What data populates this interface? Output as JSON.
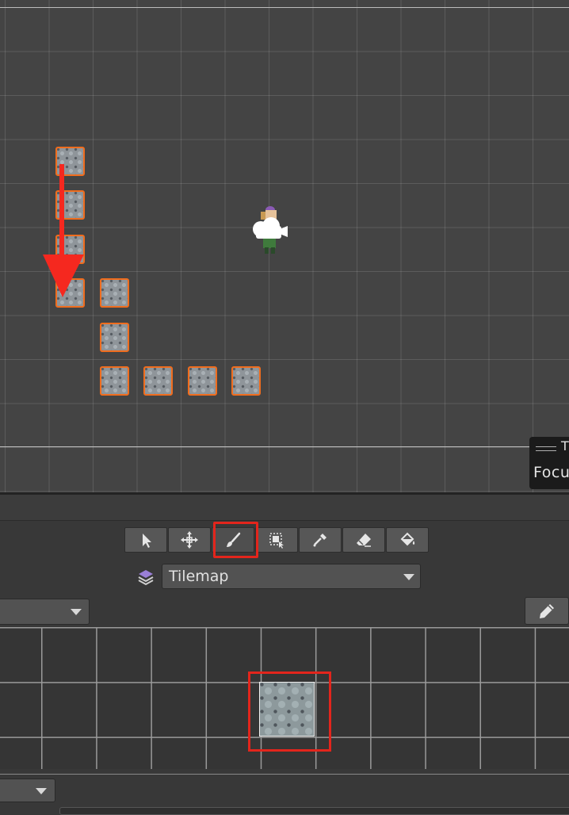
{
  "scene": {
    "focus_panel": {
      "title_fragment": "T",
      "label": "Focu"
    },
    "camera_icon": "camera-gizmo-icon",
    "player_sprite": "player-sprite"
  },
  "tile_palette": {
    "tools": [
      {
        "name": "select-tool",
        "icon": "arrow-cursor-icon"
      },
      {
        "name": "move-tool",
        "icon": "move-arrows-icon"
      },
      {
        "name": "paint-brush-tool",
        "icon": "paintbrush-icon",
        "active": true
      },
      {
        "name": "box-fill-tool",
        "icon": "box-select-icon"
      },
      {
        "name": "pick-tool",
        "icon": "eyedropper-icon"
      },
      {
        "name": "erase-tool",
        "icon": "eraser-icon"
      },
      {
        "name": "fill-tool",
        "icon": "paint-bucket-icon"
      }
    ],
    "active_tilemap": "Tilemap",
    "edit_icon": "pencil-icon"
  },
  "colors": {
    "highlight": "#e3251c",
    "tile_outline": "#f06d1e",
    "arrow": "#f5281f"
  }
}
